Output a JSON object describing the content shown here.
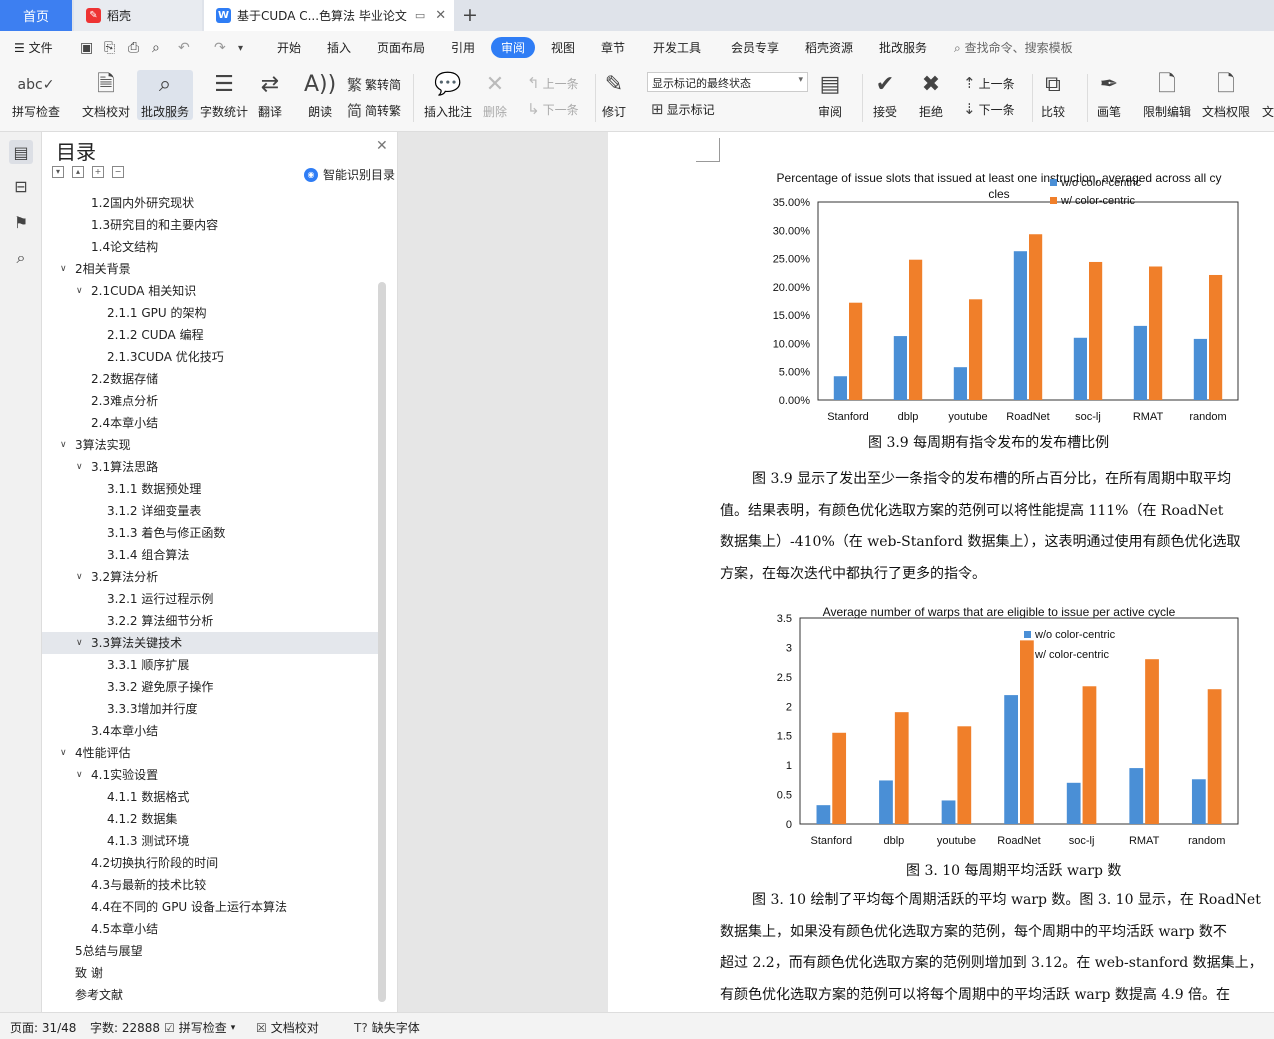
{
  "titlebar": {
    "home_tab": "首页",
    "daoke_tab": "稻壳",
    "doc_tab": "基于CUDA C...色算法 毕业论文",
    "new_tab": "+"
  },
  "menubar": {
    "file": "文件",
    "items": [
      "开始",
      "插入",
      "页面布局",
      "引用",
      "审阅",
      "视图",
      "章节",
      "开发工具",
      "会员专享",
      "稻壳资源",
      "批改服务"
    ],
    "active": "审阅",
    "search": "查找命令、搜索模板"
  },
  "toolbar": {
    "spell_check": "拼写检查",
    "doc_proof": "文档校对",
    "correction_service": "批改服务",
    "word_count": "字数统计",
    "translate": "翻译",
    "read_aloud": "朗读",
    "to_traditional": "繁转简",
    "to_simplified": "简转繁",
    "insert_comment": "插入批注",
    "delete": "删除",
    "prev_comment": "上一条",
    "next_comment": "下一条",
    "track": "修订",
    "markup_state": "显示标记的最终状态",
    "show_markup": "显示标记",
    "review": "审阅",
    "accept": "接受",
    "reject": "拒绝",
    "prev_change": "上一条",
    "next_change": "下一条",
    "compare": "比较",
    "pen": "画笔",
    "restrict_edit": "限制编辑",
    "doc_permission": "文档权限",
    "cut_off": "文"
  },
  "toc": {
    "title": "目录",
    "smart": "智能识别目录",
    "items": [
      {
        "text": "1.2国内外研究现状",
        "level": 2,
        "chev": ""
      },
      {
        "text": "1.3研究目的和主要内容",
        "level": 2,
        "chev": ""
      },
      {
        "text": "1.4论文结构",
        "level": 2,
        "chev": ""
      },
      {
        "text": "2相关背景",
        "level": 1,
        "chev": "v"
      },
      {
        "text": "2.1CUDA 相关知识",
        "level": 2,
        "chev": "v"
      },
      {
        "text": "2.1.1  GPU 的架构",
        "level": 3,
        "chev": ""
      },
      {
        "text": "2.1.2  CUDA 编程",
        "level": 3,
        "chev": ""
      },
      {
        "text": "2.1.3CUDA 优化技巧",
        "level": 3,
        "chev": ""
      },
      {
        "text": "2.2数据存储",
        "level": 2,
        "chev": ""
      },
      {
        "text": "2.3难点分析",
        "level": 2,
        "chev": ""
      },
      {
        "text": "2.4本章小结",
        "level": 2,
        "chev": ""
      },
      {
        "text": "3算法实现",
        "level": 1,
        "chev": "v"
      },
      {
        "text": "3.1算法思路",
        "level": 2,
        "chev": "v"
      },
      {
        "text": "3.1.1  数据预处理",
        "level": 3,
        "chev": ""
      },
      {
        "text": "3.1.2  详细变量表",
        "level": 3,
        "chev": ""
      },
      {
        "text": "3.1.3  着色与修正函数",
        "level": 3,
        "chev": ""
      },
      {
        "text": "3.1.4  组合算法",
        "level": 3,
        "chev": ""
      },
      {
        "text": "3.2算法分析",
        "level": 2,
        "chev": "v"
      },
      {
        "text": "3.2.1  运行过程示例",
        "level": 3,
        "chev": ""
      },
      {
        "text": "3.2.2  算法细节分析",
        "level": 3,
        "chev": ""
      },
      {
        "text": "3.3算法关键技术",
        "level": 2,
        "chev": "v",
        "selected": true
      },
      {
        "text": "3.3.1  顺序扩展",
        "level": 3,
        "chev": ""
      },
      {
        "text": "3.3.2  避免原子操作",
        "level": 3,
        "chev": ""
      },
      {
        "text": "3.3.3增加并行度",
        "level": 3,
        "chev": ""
      },
      {
        "text": "3.4本章小结",
        "level": 2,
        "chev": ""
      },
      {
        "text": "4性能评估",
        "level": 1,
        "chev": "v"
      },
      {
        "text": "4.1实验设置",
        "level": 2,
        "chev": "v"
      },
      {
        "text": "4.1.1  数据格式",
        "level": 3,
        "chev": ""
      },
      {
        "text": "4.1.2  数据集",
        "level": 3,
        "chev": ""
      },
      {
        "text": "4.1.3  测试环境",
        "level": 3,
        "chev": ""
      },
      {
        "text": "4.2切换执行阶段的时间",
        "level": 2,
        "chev": ""
      },
      {
        "text": "4.3与最新的技术比较",
        "level": 2,
        "chev": ""
      },
      {
        "text": "4.4在不同的 GPU 设备上运行本算法",
        "level": 2,
        "chev": ""
      },
      {
        "text": "4.5本章小结",
        "level": 2,
        "chev": ""
      },
      {
        "text": "5总结与展望",
        "level": 1,
        "chev": ""
      },
      {
        "text": "致    谢",
        "level": 1,
        "chev": ""
      },
      {
        "text": "参考文献",
        "level": 1,
        "chev": ""
      }
    ]
  },
  "document": {
    "caption1": "图 3.9  每周期有指令发布的发布槽比例",
    "para1": [
      "图 3.9 显示了发出至少一条指令的发布槽的所占百分比，在所有周期中取平均",
      "值。结果表明，有颜色优化选取方案的范例可以将性能提高 111%（在 RoadNet",
      "数据集上）-410%（在 web-Stanford 数据集上），这表明通过使用有颜色优化选取",
      "方案，在每次迭代中都执行了更多的指令。"
    ],
    "caption2": "图 3. 10  每周期平均活跃 warp 数",
    "para2": [
      "图 3. 10 绘制了平均每个周期活跃的平均 warp 数。图 3. 10 显示，在 RoadNet",
      "数据集上，如果没有颜色优化选取方案的范例，每个周期中的平均活跃 warp 数不",
      "超过 2.2，而有颜色优化选取方案的范例则增加到 3.12。在 web-stanford 数据集上，",
      "有颜色优化选取方案的范例可以将每个周期中的平均活跃 warp 数提高 4.9 倍。在"
    ]
  },
  "status": {
    "page": "页面: 31/48",
    "words": "字数: 22888",
    "spell": "拼写检查",
    "proof": "文档校对",
    "missing_font": "缺失字体"
  },
  "colors": {
    "series1": "#4a8fd6",
    "series2": "#f07f2a",
    "accent": "#2f7df5"
  },
  "chart_data": [
    {
      "type": "bar",
      "title": "Percentage of issue slots that issued at least one instruction, averaged across all cycles",
      "categories": [
        "Stanford",
        "dblp",
        "youtube",
        "RoadNet",
        "soc-lj",
        "RMAT",
        "random"
      ],
      "series": [
        {
          "name": "w/o color-centric",
          "values": [
            4.2,
            11.3,
            5.8,
            26.3,
            11.0,
            13.1,
            10.8
          ]
        },
        {
          "name": "w/ color-centric",
          "values": [
            17.2,
            24.8,
            17.8,
            29.3,
            24.4,
            23.6,
            22.1
          ]
        }
      ],
      "ylim": [
        0,
        35
      ],
      "yticks": [
        "0.00%",
        "5.00%",
        "10.00%",
        "15.00%",
        "20.00%",
        "25.00%",
        "30.00%",
        "35.00%"
      ],
      "legend": "top-right",
      "grid": false
    },
    {
      "type": "bar",
      "title": "Average number of warps that are eligible to issue per active cycle",
      "categories": [
        "Stanford",
        "dblp",
        "youtube",
        "RoadNet",
        "soc-lj",
        "RMAT",
        "random"
      ],
      "series": [
        {
          "name": "w/o color-centric",
          "values": [
            0.32,
            0.74,
            0.4,
            2.19,
            0.7,
            0.95,
            0.76
          ]
        },
        {
          "name": "w/ color-centric",
          "values": [
            1.55,
            1.9,
            1.66,
            3.12,
            2.34,
            2.8,
            2.29
          ]
        }
      ],
      "ylim": [
        0,
        3.5
      ],
      "yticks": [
        "0",
        "0.5",
        "1",
        "1.5",
        "2",
        "2.5",
        "3",
        "3.5"
      ],
      "legend": "top-right",
      "grid": false
    }
  ]
}
